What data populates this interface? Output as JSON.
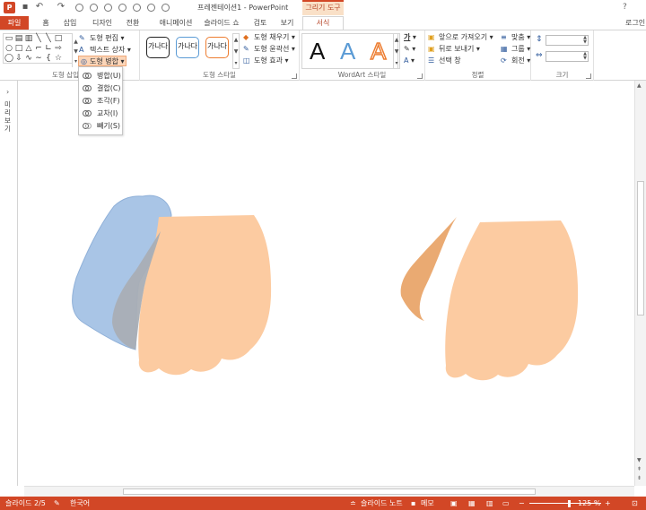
{
  "window": {
    "title": "프레젠테이션1 - PowerPoint",
    "contextual_tab_group": "그리기 도구",
    "help": "?",
    "user": "로그인"
  },
  "tabs": {
    "file": "파일",
    "home": "홈",
    "insert": "삽입",
    "design": "디자인",
    "transitions": "전환",
    "animations": "애니메이션",
    "slideshow": "슬라이드 쇼",
    "review": "검토",
    "view": "보기",
    "format": "서식"
  },
  "ribbon": {
    "insert_shapes": {
      "label": "도형 삽입",
      "edit_shape": "도형 편집",
      "text_box": "텍스트 상자",
      "merge_shapes": "도형 병합"
    },
    "shape_styles": {
      "label": "도형 스타일",
      "style_sample": "가나다",
      "fill": "도형 채우기",
      "outline": "도형 윤곽선",
      "effects": "도형 효과"
    },
    "wordart": {
      "label": "WordArt 스타일",
      "sample": "A"
    },
    "arrange": {
      "label": "정렬",
      "bring_forward": "앞으로 가져오기",
      "send_backward": "뒤로 보내기",
      "selection_pane": "선택 창",
      "align": "맞춤",
      "group": "그룹",
      "rotate": "회전"
    },
    "size": {
      "label": "크기"
    }
  },
  "merge_menu": {
    "items": [
      {
        "label": "병합(U)",
        "enabled": true
      },
      {
        "label": "결합(C)",
        "enabled": true
      },
      {
        "label": "조각(F)",
        "enabled": true
      },
      {
        "label": "교차(I)",
        "enabled": true
      },
      {
        "label": "빼기(S)",
        "enabled": true
      }
    ]
  },
  "thumbnail_pane": {
    "label": "미리 보기"
  },
  "statusbar": {
    "slide_position": "슬라이드 2/5",
    "language": "한국어",
    "notes": "슬라이드 노트",
    "comments": "메모",
    "zoom": "125 %",
    "zoom_fraction": 0.56
  },
  "colors": {
    "accent": "#d24726",
    "skin": "#fccba1",
    "blue_shape": "#a9c5e6",
    "overlap": "#a9aeb5",
    "orange_sliver": "#eaaa72"
  }
}
